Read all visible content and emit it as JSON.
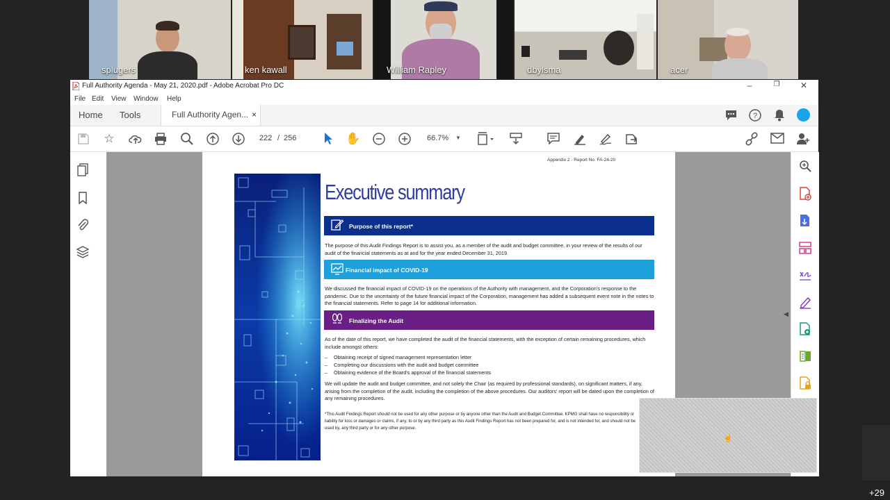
{
  "participants": [
    {
      "name": "splugers"
    },
    {
      "name": "ken kawall"
    },
    {
      "name": "William Rapley"
    },
    {
      "name": "dbylsma"
    },
    {
      "name": "acer"
    }
  ],
  "extra_participants": "+29",
  "window": {
    "title": "Full Authority Agenda - May 21, 2020.pdf - Adobe Acrobat Pro DC",
    "minimize": "–",
    "restore": "❐",
    "close": "✕"
  },
  "menu": [
    "File",
    "Edit",
    "View",
    "Window",
    "Help"
  ],
  "tabs": {
    "home": "Home",
    "tools": "Tools",
    "document": "Full Authority Agen...",
    "close": "×"
  },
  "toolbar": {
    "page_current": "222",
    "page_sep": "/",
    "page_total": "256",
    "zoom": "66.7%"
  },
  "page": {
    "appendix": "Appendix 2 - Report No. FA-24-20",
    "heading": "Executive summary",
    "sections": [
      {
        "title": "Purpose of this report*",
        "color": "#0a2f8c"
      },
      {
        "title": "Financial impact of COVID-19",
        "color": "#1ea0dc"
      },
      {
        "title": "Finalizing the Audit",
        "color": "#6a1f84"
      }
    ],
    "purpose_text": "The purpose of this Audit Findings Report is to assist you, as a member of the audit and budget committee, in your review of the results of our audit of the financial statements as at and for the year ended December 31, 2019.",
    "covid_text": "We discussed the financial impact of COVID-19 on the operations of the Authority with management, and the Corporation's response to the pandemic. Due to the uncertainty of the future financial impact of the Corporation, management has added a subsequent event note in the notes to the financial statements. Refer to page 14 for additional information.",
    "final_intro": "As of the date of this report, we have completed the audit of the financial statements, with the exception of certain remaining procedures, which include amongst others:",
    "bullets": [
      "Obtaining receipt of signed management representation letter",
      "Completing our discussions with the audit and budget committee",
      "Obtaining evidence of the Board's approval of the financial statements"
    ],
    "final_text": "We will update the audit and budget committee, and not solely the Chair (as required by professional standards), on significant matters, if any, arising from the completion of the audit, including the completion of the above procedures. Our auditors' report will be dated upon the completion of any remaining procedures.",
    "footnote": "*This Audit Findings Report should not be used for any other purpose or by anyone other than the Audit and Budget Committee. KPMG shall have no responsibility or liability for loss or damages or claims, if any, to or by any third party as this Audit Findings Report has not been prepared for, and is not intended for, and should not be used by, any third party or for any other purpose."
  },
  "colors": {
    "accent": "#1aa3e8",
    "heading": "#2f3e9e"
  }
}
